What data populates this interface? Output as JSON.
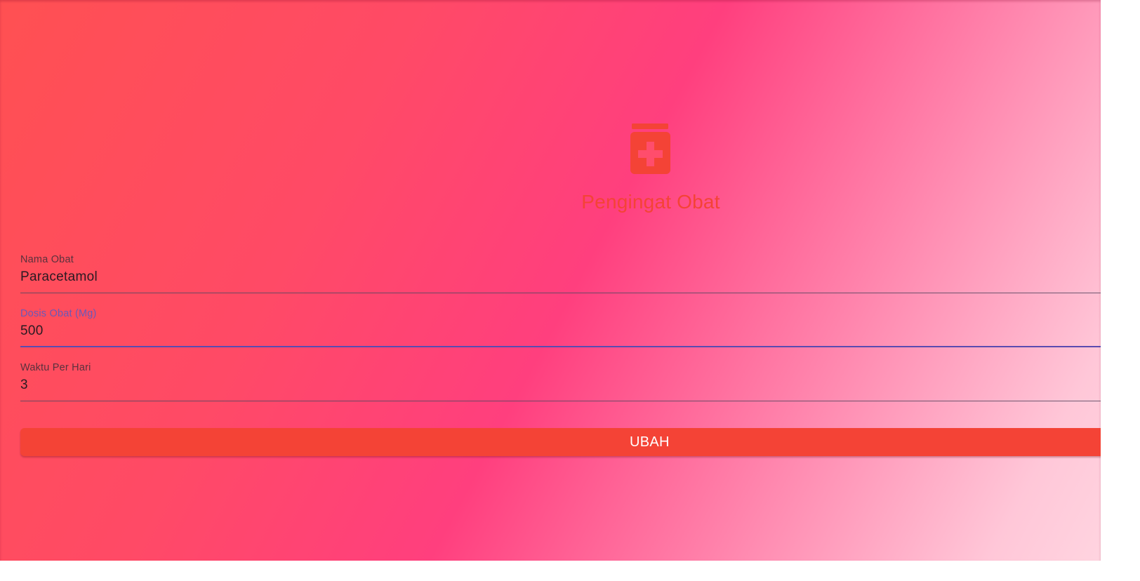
{
  "app": {
    "title": "Pengingat Obat",
    "logo_icon": "medicine-bottle-icon",
    "accent_color": "#f44336"
  },
  "form": {
    "fields": [
      {
        "label": "Nama Obat",
        "value": "Paracetamol",
        "focused": false
      },
      {
        "label": "Dosis Obat (Mg)",
        "value": "500",
        "focused": true
      },
      {
        "label": "Waktu Per Hari",
        "value": "3",
        "focused": false
      }
    ],
    "submit_label": "UBAH"
  }
}
